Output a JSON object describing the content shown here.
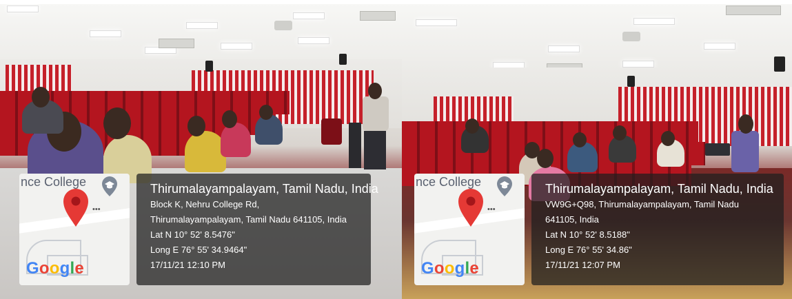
{
  "photos": [
    {
      "map": {
        "label": "nce College",
        "pin_icon": "map-pin-icon",
        "grad_icon": "graduation-cap-icon",
        "logo": "Google"
      },
      "location": {
        "title": "Thirumalayampalayam, Tamil Nadu, India",
        "address_line1": "Block K, Nehru College Rd,",
        "address_line2": "Thirumalayampalayam, Tamil Nadu 641105, India",
        "lat": "Lat N 10° 52' 8.5476\"",
        "long": "Long E 76° 55' 34.9464\"",
        "timestamp": "17/11/21 12:10 PM"
      }
    },
    {
      "map": {
        "label": "nce College",
        "pin_icon": "map-pin-icon",
        "grad_icon": "graduation-cap-icon",
        "logo": "Google"
      },
      "location": {
        "title": "Thirumalayampalayam, Tamil Nadu, India",
        "address_line1": "VW9G+Q98, Thirumalayampalayam, Tamil Nadu",
        "address_line2": "641105, India",
        "lat": "Lat N 10° 52' 8.5188\"",
        "long": "Long E 76° 55' 34.86\"",
        "timestamp": "17/11/21 12:07 PM"
      }
    }
  ],
  "colors": {
    "curtain_red": "#c5202a",
    "seat_red": "#b4151f",
    "overlay_bg": "rgba(30,30,30,0.72)",
    "pin_red": "#e53935",
    "google_blue": "#4285f4",
    "google_red": "#ea4335",
    "google_yellow": "#fbbc05",
    "google_green": "#34a853"
  }
}
